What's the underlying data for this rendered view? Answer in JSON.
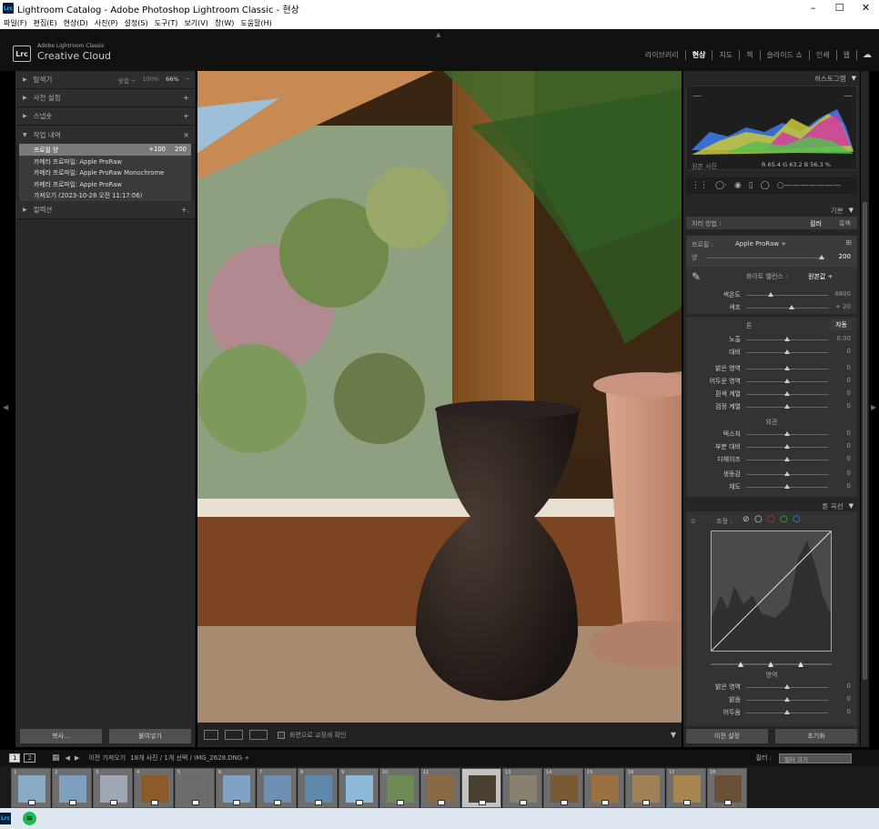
{
  "window": {
    "title": "Lightroom Catalog - Adobe Photoshop Lightroom Classic - 현상",
    "app_badge": "Lrc",
    "minimize": "–",
    "maximize": "☐",
    "close": "✕"
  },
  "menu": [
    "파일(F)",
    "편집(E)",
    "현상(D)",
    "사진(P)",
    "설정(S)",
    "도구(T)",
    "보기(V)",
    "창(W)",
    "도움말(H)"
  ],
  "identity": {
    "logo": "Lrc",
    "brand_small": "Adobe Lightroom Classic",
    "brand_big": "Creative Cloud"
  },
  "modules": [
    {
      "label": "라이브러리",
      "active": false
    },
    {
      "label": "현상",
      "active": true
    },
    {
      "label": "지도",
      "active": false
    },
    {
      "label": "책",
      "active": false
    },
    {
      "label": "슬라이드 쇼",
      "active": false
    },
    {
      "label": "인쇄",
      "active": false
    },
    {
      "label": "웹",
      "active": false
    }
  ],
  "left_panel": {
    "navigator": {
      "label": "탐색기",
      "fit": "맞춤 ÷",
      "zoom1": "100%",
      "zoom2": "66%",
      "arrow": "÷"
    },
    "presets": {
      "label": "사전 설정",
      "action": "+"
    },
    "snapshots": {
      "label": "스냅숏",
      "action": "+"
    },
    "history": {
      "label": "작업 내역",
      "action": "×",
      "items": [
        {
          "text": "프로필 양",
          "v1": "+100",
          "v2": "200",
          "selected": true
        },
        {
          "text": "카메라 프로파일: Apple ProRaw",
          "v1": "",
          "v2": "",
          "selected": false
        },
        {
          "text": "카메라 프로파일: Apple ProRaw Monochrome",
          "v1": "",
          "v2": "",
          "selected": false
        },
        {
          "text": "카메라 프로파일: Apple ProRaw",
          "v1": "",
          "v2": "",
          "selected": false
        },
        {
          "text": "가져오기 (2023-10-28 오전 11:17:06)",
          "v1": "",
          "v2": "",
          "selected": false
        }
      ]
    },
    "collections": {
      "label": "컬렉션",
      "action": "+."
    },
    "copy_button": "복사...",
    "paste_button": "붙여넣기"
  },
  "toolbar": {
    "softproof": "화면으로 교정쇄 확인"
  },
  "right_panel": {
    "histogram_label": "히스토그램",
    "rgb_readout": "R  65.4   G  63.2   B  56.3  %",
    "original_photo": "원본 사진",
    "basic_label": "기본",
    "treatment_label": "처리 방법 :",
    "treatment_color": "컬러",
    "treatment_bw": "흑백",
    "profile_label": "프로필 :",
    "profile_value": "Apple ProRaw ÷",
    "amount_label": "양",
    "amount_value": "200",
    "amount_pos": 0.98,
    "wb_label": "화이트 밸런스 :",
    "wb_value": "원본값 ÷",
    "wb_sliders": [
      {
        "label": "색온도",
        "value": "4800",
        "pos": 0.3
      },
      {
        "label": "색조",
        "value": "+ 20",
        "pos": 0.55
      }
    ],
    "tone_label": "톤",
    "tone_auto": "자동",
    "tone_sliders": [
      {
        "label": "노출",
        "value": "0.00",
        "pos": 0.5
      },
      {
        "label": "대비",
        "value": "0",
        "pos": 0.5
      }
    ],
    "light_sliders": [
      {
        "label": "밝은 영역",
        "value": "0",
        "pos": 0.5
      },
      {
        "label": "어두운 영역",
        "value": "0",
        "pos": 0.5
      },
      {
        "label": "흰색 계열",
        "value": "0",
        "pos": 0.5
      },
      {
        "label": "검정 계열",
        "value": "0",
        "pos": 0.5
      }
    ],
    "presence_label": "외관",
    "presence_sliders": [
      {
        "label": "텍스처",
        "value": "0",
        "pos": 0.5
      },
      {
        "label": "부분 대비",
        "value": "0",
        "pos": 0.5
      },
      {
        "label": "디헤이즈",
        "value": "0",
        "pos": 0.5
      }
    ],
    "color_sliders": [
      {
        "label": "생동감",
        "value": "0",
        "pos": 0.5
      },
      {
        "label": "채도",
        "value": "0",
        "pos": 0.5
      }
    ],
    "tone_curve_label": "톤 곡선",
    "adjust_label": "조정 :",
    "region_label": "영역",
    "region_sliders": [
      {
        "label": "밝은 영역",
        "value": "0",
        "pos": 0.5
      },
      {
        "label": "밝음",
        "value": "0",
        "pos": 0.5
      },
      {
        "label": "어두움",
        "value": "0",
        "pos": 0.5
      }
    ],
    "previous_button": "이전 설정",
    "reset_button": "초기화"
  },
  "filmstrip_bar": {
    "view1": "1",
    "view2": "2",
    "source": "이전 가져오기",
    "count": "18개 사진 / 1개 선택 / IMG_2628.DNG ÷",
    "filter_label": "필터 :",
    "filter_value": "필터 끄기"
  },
  "filmstrip": [
    {
      "idx": "1",
      "selected": false,
      "color": "#8aa9c4"
    },
    {
      "idx": "2",
      "selected": false,
      "color": "#7e9fbe"
    },
    {
      "idx": "3",
      "selected": false,
      "color": "#a0a8b5"
    },
    {
      "idx": "4",
      "selected": false,
      "color": "#8c5a2b"
    },
    {
      "idx": "5",
      "selected": false,
      "color": "#6b6b6b"
    },
    {
      "idx": "6",
      "selected": false,
      "color": "#7fa2c5"
    },
    {
      "idx": "7",
      "selected": false,
      "color": "#6e91b3"
    },
    {
      "idx": "8",
      "selected": false,
      "color": "#5f88ad"
    },
    {
      "idx": "9",
      "selected": false,
      "color": "#8fb9d8"
    },
    {
      "idx": "10",
      "selected": false,
      "color": "#6d8a55"
    },
    {
      "idx": "11",
      "selected": false,
      "color": "#8a6a45"
    },
    {
      "idx": "12",
      "selected": true,
      "color": "#4a4030"
    },
    {
      "idx": "13",
      "selected": false,
      "color": "#8a8070"
    },
    {
      "idx": "14",
      "selected": false,
      "color": "#7a5a35"
    },
    {
      "idx": "15",
      "selected": false,
      "color": "#9a7040"
    },
    {
      "idx": "16",
      "selected": false,
      "color": "#a08055"
    },
    {
      "idx": "17",
      "selected": false,
      "color": "#a88550"
    },
    {
      "idx": "18",
      "selected": false,
      "color": "#6a5036"
    }
  ],
  "taskbar": {
    "lrc": "Lrc",
    "spotify": "≋"
  }
}
